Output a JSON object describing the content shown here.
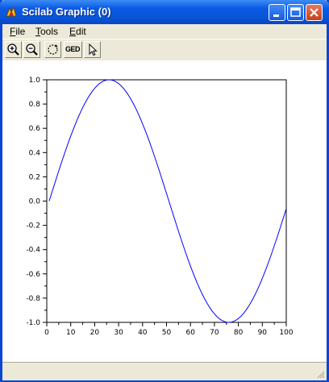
{
  "window": {
    "title": "Scilab Graphic (0)",
    "accent_color": "#0a5ae6",
    "controls": [
      "minimize-icon",
      "maximize-icon",
      "close-icon"
    ]
  },
  "menu": {
    "file": {
      "first": "F",
      "rest": "ile"
    },
    "tools": {
      "first": "T",
      "rest": "ools"
    },
    "edit": {
      "first": "E",
      "rest": "dit"
    }
  },
  "toolbar": {
    "buttons": [
      "zoom-in-icon",
      "zoom-out-icon",
      "rotate-icon",
      "ged-icon",
      "pointer-icon"
    ],
    "ged_label": "GED"
  },
  "chart_data": {
    "type": "line",
    "title": "",
    "xlabel": "",
    "ylabel": "",
    "xlim": [
      0,
      100
    ],
    "ylim": [
      -1.0,
      1.0
    ],
    "x_ticks": [
      0,
      10,
      20,
      30,
      40,
      50,
      60,
      70,
      80,
      90,
      100
    ],
    "x_tick_labels": [
      "0",
      "10",
      "20",
      "30",
      "40",
      "50",
      "60",
      "70",
      "80",
      "90",
      "100"
    ],
    "y_ticks": [
      -1.0,
      -0.8,
      -0.6,
      -0.4,
      -0.2,
      0.0,
      0.2,
      0.4,
      0.6,
      0.8,
      1.0
    ],
    "y_tick_labels": [
      "-1.0",
      "-0.8",
      "-0.6",
      "-0.4",
      "-0.2",
      "0.0",
      "0.2",
      "0.4",
      "0.6",
      "0.8",
      "1.0"
    ],
    "grid": false,
    "series": [
      {
        "color": "#0000ff",
        "x": [
          1,
          2,
          3,
          4,
          5,
          6,
          7,
          8,
          9,
          10,
          11,
          12,
          13,
          14,
          15,
          16,
          17,
          18,
          19,
          20,
          21,
          22,
          23,
          24,
          25,
          26,
          27,
          28,
          29,
          30,
          31,
          32,
          33,
          34,
          35,
          36,
          37,
          38,
          39,
          40,
          41,
          42,
          43,
          44,
          45,
          46,
          47,
          48,
          49,
          50,
          51,
          52,
          53,
          54,
          55,
          56,
          57,
          58,
          59,
          60,
          61,
          62,
          63,
          64,
          65,
          66,
          67,
          68,
          69,
          70,
          71,
          72,
          73,
          74,
          75,
          76,
          77,
          78,
          79,
          80,
          81,
          82,
          83,
          84,
          85,
          86,
          87,
          88,
          89,
          90,
          91,
          92,
          93,
          94,
          95,
          96,
          97,
          98,
          99,
          100
        ],
        "y": [
          0.0,
          0.063,
          0.125,
          0.187,
          0.249,
          0.309,
          0.368,
          0.426,
          0.482,
          0.536,
          0.588,
          0.637,
          0.685,
          0.729,
          0.771,
          0.809,
          0.844,
          0.876,
          0.905,
          0.93,
          0.951,
          0.969,
          0.982,
          0.992,
          0.998,
          1.0,
          0.998,
          0.992,
          0.982,
          0.969,
          0.951,
          0.93,
          0.905,
          0.876,
          0.844,
          0.809,
          0.771,
          0.729,
          0.685,
          0.637,
          0.588,
          0.536,
          0.482,
          0.426,
          0.368,
          0.309,
          0.249,
          0.187,
          0.125,
          0.063,
          0.0,
          -0.063,
          -0.125,
          -0.187,
          -0.249,
          -0.309,
          -0.368,
          -0.426,
          -0.482,
          -0.536,
          -0.588,
          -0.637,
          -0.685,
          -0.729,
          -0.771,
          -0.809,
          -0.844,
          -0.876,
          -0.905,
          -0.93,
          -0.951,
          -0.969,
          -0.982,
          -0.992,
          -0.998,
          -1.0,
          -0.998,
          -0.992,
          -0.982,
          -0.969,
          -0.951,
          -0.93,
          -0.905,
          -0.876,
          -0.844,
          -0.809,
          -0.771,
          -0.729,
          -0.685,
          -0.637,
          -0.588,
          -0.536,
          -0.482,
          -0.426,
          -0.368,
          -0.309,
          -0.249,
          -0.187,
          -0.125,
          -0.063
        ]
      }
    ]
  }
}
